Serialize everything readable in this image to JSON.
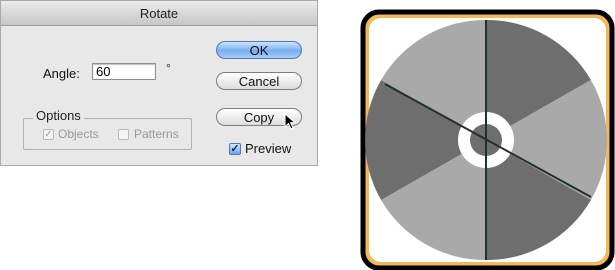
{
  "dialog": {
    "title": "Rotate",
    "angle_label": "Angle:",
    "angle_value": "60",
    "degree_symbol": "°",
    "options_label": "Options",
    "objects_label": "Objects",
    "patterns_label": "Patterns",
    "ok_label": "OK",
    "cancel_label": "Cancel",
    "copy_label": "Copy",
    "preview_label": "Preview",
    "objects_checked": true,
    "patterns_checked": false,
    "preview_checked": true
  },
  "colors": {
    "frame_border": "#000000",
    "frame_fill": "#f2b85a",
    "disc_light": "#a9a9a9",
    "disc_dark": "#6e6e6e",
    "hub": "#ffffff",
    "axis_line": "#1f3326",
    "default_button": "#78aef0"
  },
  "icons": {
    "cursor": "arrow-cursor-icon",
    "degree": "degree-symbol"
  }
}
